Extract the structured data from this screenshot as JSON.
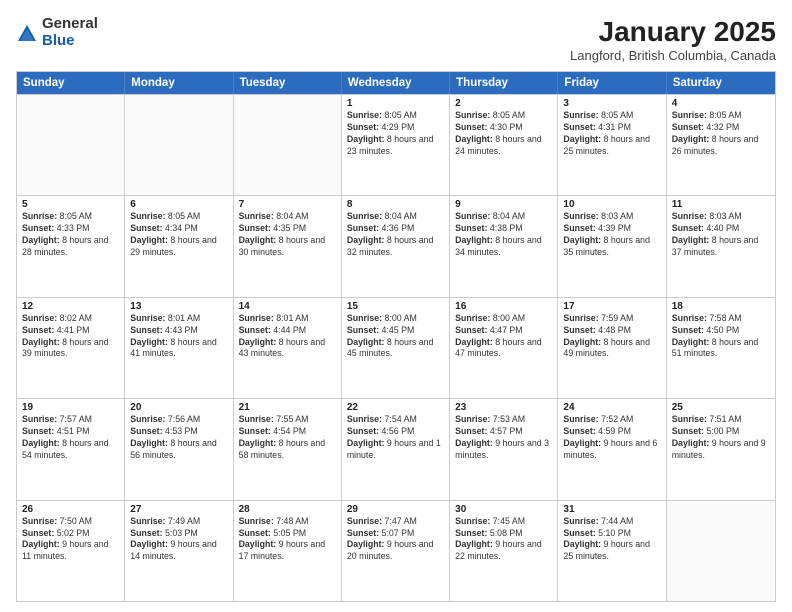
{
  "header": {
    "logo": {
      "general": "General",
      "blue": "Blue"
    },
    "title": "January 2025",
    "subtitle": "Langford, British Columbia, Canada"
  },
  "calendar": {
    "days_of_week": [
      "Sunday",
      "Monday",
      "Tuesday",
      "Wednesday",
      "Thursday",
      "Friday",
      "Saturday"
    ],
    "weeks": [
      [
        {
          "day": "",
          "info": "",
          "empty": true
        },
        {
          "day": "",
          "info": "",
          "empty": true
        },
        {
          "day": "",
          "info": "",
          "empty": true
        },
        {
          "day": "1",
          "info": "Sunrise: 8:05 AM\nSunset: 4:29 PM\nDaylight: 8 hours and 23 minutes.",
          "empty": false
        },
        {
          "day": "2",
          "info": "Sunrise: 8:05 AM\nSunset: 4:30 PM\nDaylight: 8 hours and 24 minutes.",
          "empty": false
        },
        {
          "day": "3",
          "info": "Sunrise: 8:05 AM\nSunset: 4:31 PM\nDaylight: 8 hours and 25 minutes.",
          "empty": false
        },
        {
          "day": "4",
          "info": "Sunrise: 8:05 AM\nSunset: 4:32 PM\nDaylight: 8 hours and 26 minutes.",
          "empty": false
        }
      ],
      [
        {
          "day": "5",
          "info": "Sunrise: 8:05 AM\nSunset: 4:33 PM\nDaylight: 8 hours and 28 minutes.",
          "empty": false
        },
        {
          "day": "6",
          "info": "Sunrise: 8:05 AM\nSunset: 4:34 PM\nDaylight: 8 hours and 29 minutes.",
          "empty": false
        },
        {
          "day": "7",
          "info": "Sunrise: 8:04 AM\nSunset: 4:35 PM\nDaylight: 8 hours and 30 minutes.",
          "empty": false
        },
        {
          "day": "8",
          "info": "Sunrise: 8:04 AM\nSunset: 4:36 PM\nDaylight: 8 hours and 32 minutes.",
          "empty": false
        },
        {
          "day": "9",
          "info": "Sunrise: 8:04 AM\nSunset: 4:38 PM\nDaylight: 8 hours and 34 minutes.",
          "empty": false
        },
        {
          "day": "10",
          "info": "Sunrise: 8:03 AM\nSunset: 4:39 PM\nDaylight: 8 hours and 35 minutes.",
          "empty": false
        },
        {
          "day": "11",
          "info": "Sunrise: 8:03 AM\nSunset: 4:40 PM\nDaylight: 8 hours and 37 minutes.",
          "empty": false
        }
      ],
      [
        {
          "day": "12",
          "info": "Sunrise: 8:02 AM\nSunset: 4:41 PM\nDaylight: 8 hours and 39 minutes.",
          "empty": false
        },
        {
          "day": "13",
          "info": "Sunrise: 8:01 AM\nSunset: 4:43 PM\nDaylight: 8 hours and 41 minutes.",
          "empty": false
        },
        {
          "day": "14",
          "info": "Sunrise: 8:01 AM\nSunset: 4:44 PM\nDaylight: 8 hours and 43 minutes.",
          "empty": false
        },
        {
          "day": "15",
          "info": "Sunrise: 8:00 AM\nSunset: 4:45 PM\nDaylight: 8 hours and 45 minutes.",
          "empty": false
        },
        {
          "day": "16",
          "info": "Sunrise: 8:00 AM\nSunset: 4:47 PM\nDaylight: 8 hours and 47 minutes.",
          "empty": false
        },
        {
          "day": "17",
          "info": "Sunrise: 7:59 AM\nSunset: 4:48 PM\nDaylight: 8 hours and 49 minutes.",
          "empty": false
        },
        {
          "day": "18",
          "info": "Sunrise: 7:58 AM\nSunset: 4:50 PM\nDaylight: 8 hours and 51 minutes.",
          "empty": false
        }
      ],
      [
        {
          "day": "19",
          "info": "Sunrise: 7:57 AM\nSunset: 4:51 PM\nDaylight: 8 hours and 54 minutes.",
          "empty": false
        },
        {
          "day": "20",
          "info": "Sunrise: 7:56 AM\nSunset: 4:53 PM\nDaylight: 8 hours and 56 minutes.",
          "empty": false
        },
        {
          "day": "21",
          "info": "Sunrise: 7:55 AM\nSunset: 4:54 PM\nDaylight: 8 hours and 58 minutes.",
          "empty": false
        },
        {
          "day": "22",
          "info": "Sunrise: 7:54 AM\nSunset: 4:56 PM\nDaylight: 9 hours and 1 minute.",
          "empty": false
        },
        {
          "day": "23",
          "info": "Sunrise: 7:53 AM\nSunset: 4:57 PM\nDaylight: 9 hours and 3 minutes.",
          "empty": false
        },
        {
          "day": "24",
          "info": "Sunrise: 7:52 AM\nSunset: 4:59 PM\nDaylight: 9 hours and 6 minutes.",
          "empty": false
        },
        {
          "day": "25",
          "info": "Sunrise: 7:51 AM\nSunset: 5:00 PM\nDaylight: 9 hours and 9 minutes.",
          "empty": false
        }
      ],
      [
        {
          "day": "26",
          "info": "Sunrise: 7:50 AM\nSunset: 5:02 PM\nDaylight: 9 hours and 11 minutes.",
          "empty": false
        },
        {
          "day": "27",
          "info": "Sunrise: 7:49 AM\nSunset: 5:03 PM\nDaylight: 9 hours and 14 minutes.",
          "empty": false
        },
        {
          "day": "28",
          "info": "Sunrise: 7:48 AM\nSunset: 5:05 PM\nDaylight: 9 hours and 17 minutes.",
          "empty": false
        },
        {
          "day": "29",
          "info": "Sunrise: 7:47 AM\nSunset: 5:07 PM\nDaylight: 9 hours and 20 minutes.",
          "empty": false
        },
        {
          "day": "30",
          "info": "Sunrise: 7:45 AM\nSunset: 5:08 PM\nDaylight: 9 hours and 22 minutes.",
          "empty": false
        },
        {
          "day": "31",
          "info": "Sunrise: 7:44 AM\nSunset: 5:10 PM\nDaylight: 9 hours and 25 minutes.",
          "empty": false
        },
        {
          "day": "",
          "info": "",
          "empty": true
        }
      ]
    ]
  }
}
